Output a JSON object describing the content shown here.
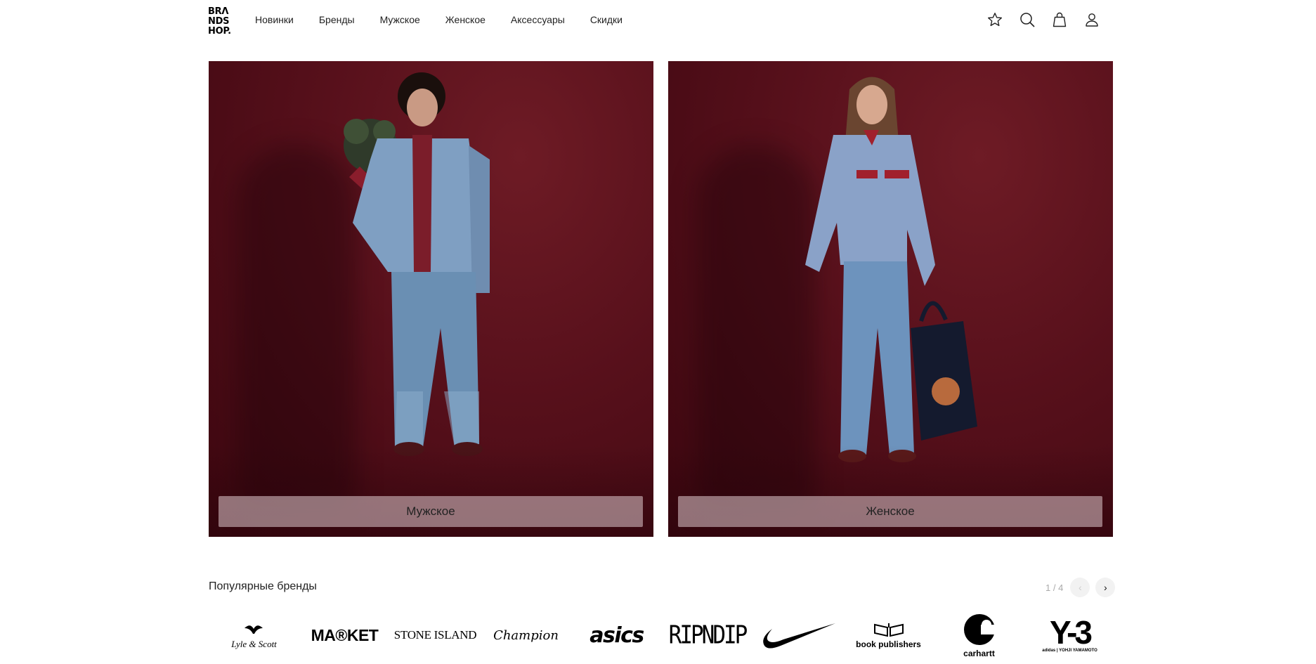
{
  "logo": {
    "lines": [
      "BRΛ",
      "NDS",
      "HOP."
    ]
  },
  "nav": {
    "items": [
      "Новинки",
      "Бренды",
      "Мужское",
      "Женское",
      "Аксессуары",
      "Скидки"
    ]
  },
  "header_icons": [
    "star-icon",
    "search-icon",
    "bag-icon",
    "user-icon"
  ],
  "hero": {
    "men_label": "Мужское",
    "women_label": "Женское",
    "background_color": "#5a111c"
  },
  "popular_brands": {
    "title": "Популярные бренды",
    "page_indicator": "1 / 4",
    "brands": [
      {
        "name": "Lyle & Scott",
        "text": "Lyle & Scott"
      },
      {
        "name": "Market",
        "text": "MA®KET"
      },
      {
        "name": "Stone Island",
        "text": "STONE ISLAND"
      },
      {
        "name": "Champion",
        "text": "Champion"
      },
      {
        "name": "Asics",
        "text": "asics"
      },
      {
        "name": "Ripndip",
        "text": "RIPNDIP"
      },
      {
        "name": "Nike",
        "text": ""
      },
      {
        "name": "Book Publishers",
        "text": "book publishers"
      },
      {
        "name": "Carhartt",
        "text": "carhartt"
      },
      {
        "name": "Y-3",
        "text": "Y-3",
        "sub": "adidas | YOHJI YAMAMOTO"
      }
    ]
  }
}
